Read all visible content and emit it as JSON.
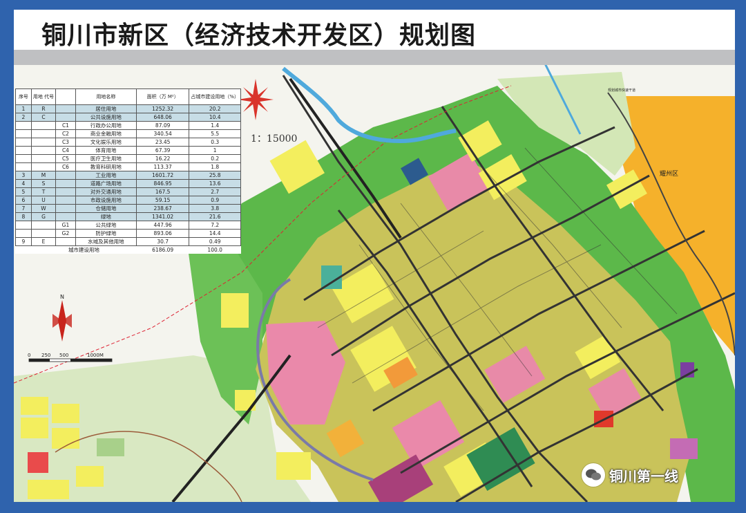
{
  "title": "铜川市新区（经济技术开发区）规划图",
  "scale_ratio": "15000",
  "scale_bar": [
    "0",
    "250",
    "500",
    "1000M"
  ],
  "north_label": "N",
  "watermark": "铜川第一线",
  "map_labels": {
    "yaozhou": "耀州区",
    "railway": "规划城市快速干道"
  },
  "legend": {
    "headers": [
      "序号",
      "用地\n代号",
      "用地名称",
      "面积（万 M²）",
      "占城市建设用地（%）"
    ],
    "rows": [
      {
        "no": "1",
        "code": "R",
        "sub": "",
        "name": "居住用地",
        "area": "1252.32",
        "pct": "20.2",
        "main": true
      },
      {
        "no": "2",
        "code": "C",
        "sub": "",
        "name": "公共设施用地",
        "area": "648.06",
        "pct": "10.4",
        "main": true
      },
      {
        "no": "",
        "code": "",
        "sub": "C1",
        "name": "行政办公用地",
        "area": "87.09",
        "pct": "1.4",
        "main": false
      },
      {
        "no": "",
        "code": "",
        "sub": "C2",
        "name": "商业金融用地",
        "area": "340.54",
        "pct": "5.5",
        "main": false
      },
      {
        "no": "",
        "code": "",
        "sub": "C3",
        "name": "文化娱乐用地",
        "area": "23.45",
        "pct": "0.3",
        "main": false
      },
      {
        "no": "",
        "code": "",
        "sub": "C4",
        "name": "体育用地",
        "area": "67.39",
        "pct": "1",
        "main": false
      },
      {
        "no": "",
        "code": "",
        "sub": "C5",
        "name": "医疗卫生用地",
        "area": "16.22",
        "pct": "0.2",
        "main": false
      },
      {
        "no": "",
        "code": "",
        "sub": "C6",
        "name": "教育科研用地",
        "area": "113.37",
        "pct": "1.8",
        "main": false
      },
      {
        "no": "3",
        "code": "M",
        "sub": "",
        "name": "工业用地",
        "area": "1601.72",
        "pct": "25.8",
        "main": true
      },
      {
        "no": "4",
        "code": "S",
        "sub": "",
        "name": "道路广场用地",
        "area": "846.95",
        "pct": "13.6",
        "main": true
      },
      {
        "no": "5",
        "code": "T",
        "sub": "",
        "name": "对外交通用地",
        "area": "167.5",
        "pct": "2.7",
        "main": true
      },
      {
        "no": "6",
        "code": "U",
        "sub": "",
        "name": "市政设施用地",
        "area": "59.15",
        "pct": "0.9",
        "main": true
      },
      {
        "no": "7",
        "code": "W",
        "sub": "",
        "name": "仓储用地",
        "area": "238.67",
        "pct": "3.8",
        "main": true
      },
      {
        "no": "8",
        "code": "G",
        "sub": "",
        "name": "绿地",
        "area": "1341.02",
        "pct": "21.6",
        "main": true
      },
      {
        "no": "",
        "code": "",
        "sub": "G1",
        "name": "公共绿地",
        "area": "447.96",
        "pct": "7.2",
        "main": false
      },
      {
        "no": "",
        "code": "",
        "sub": "G2",
        "name": "防护绿地",
        "area": "893.06",
        "pct": "14.4",
        "main": false
      },
      {
        "no": "9",
        "code": "E",
        "sub": "",
        "name": "水域及其他用地",
        "area": "30.7",
        "pct": "0.49",
        "main": false
      }
    ],
    "total_label": "城市建设用地",
    "total_area": "6186.09",
    "total_pct": "100.0"
  },
  "colors": {
    "frame": "#2f63ad",
    "green": "#5cb84a",
    "light_green": "#cfe6b0",
    "yellow": "#f3ee5e",
    "pink": "#e88aa8",
    "olive": "#a9a54a",
    "magenta": "#a8407a",
    "orange": "#f2b13a",
    "water": "#4fa9dc"
  }
}
